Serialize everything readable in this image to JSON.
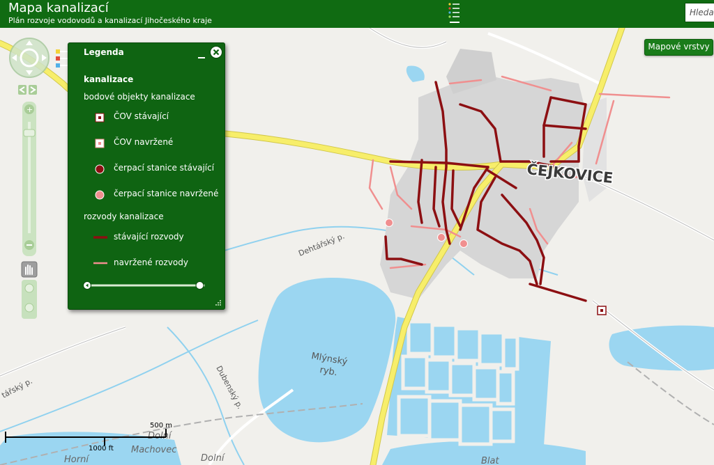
{
  "header": {
    "title": "Mapa kanalizací",
    "subtitle": "Plán rozvoje vodovodů a kanalizací Jihočeského kraje",
    "search_placeholder": "Hledat",
    "menu_icon": "legend-list-icon"
  },
  "map": {
    "layers_button": "Mapové vrstvy",
    "labels": {
      "town": "ČEJKOVICE",
      "pond": "Mlýnský",
      "pond_suffix": "ryb.",
      "stream1": "Dehtářský p.",
      "stream2": "Dubenský p.",
      "stream3": "tářský p.",
      "place1_a": "Dolní",
      "place1_b": "Machovec",
      "place2": "Horní",
      "place3": "Dolní",
      "place4": "Blat"
    },
    "scale": {
      "metric": "500 m",
      "imperial": "1000 ft"
    },
    "colors": {
      "water": "#9bd6f1",
      "built": "#d6d6d6",
      "road_main": "#f7ee6a",
      "sewer_existing": "#8c0f12",
      "sewer_planned": "#f08f8f"
    }
  },
  "legend": {
    "title": "Legenda",
    "layer": "kanalizace",
    "group1": "bodové objekty kanalizace",
    "items_points": [
      {
        "label": "ČOV stávající",
        "icon": "wwtp-existing-icon"
      },
      {
        "label": "ČOV navržené",
        "icon": "wwtp-planned-icon"
      },
      {
        "label": "čerpací stanice stávající",
        "icon": "pump-existing-icon"
      },
      {
        "label": "čerpací stanice navržené",
        "icon": "pump-planned-icon"
      }
    ],
    "group2": "rozvody kanalizace",
    "items_lines": [
      {
        "label": "stávající rozvody",
        "icon": "sewer-existing-line-icon"
      },
      {
        "label": "navržené rozvody",
        "icon": "sewer-planned-line-icon"
      }
    ],
    "opacity_slider": {
      "value_fraction": 0.95
    }
  }
}
